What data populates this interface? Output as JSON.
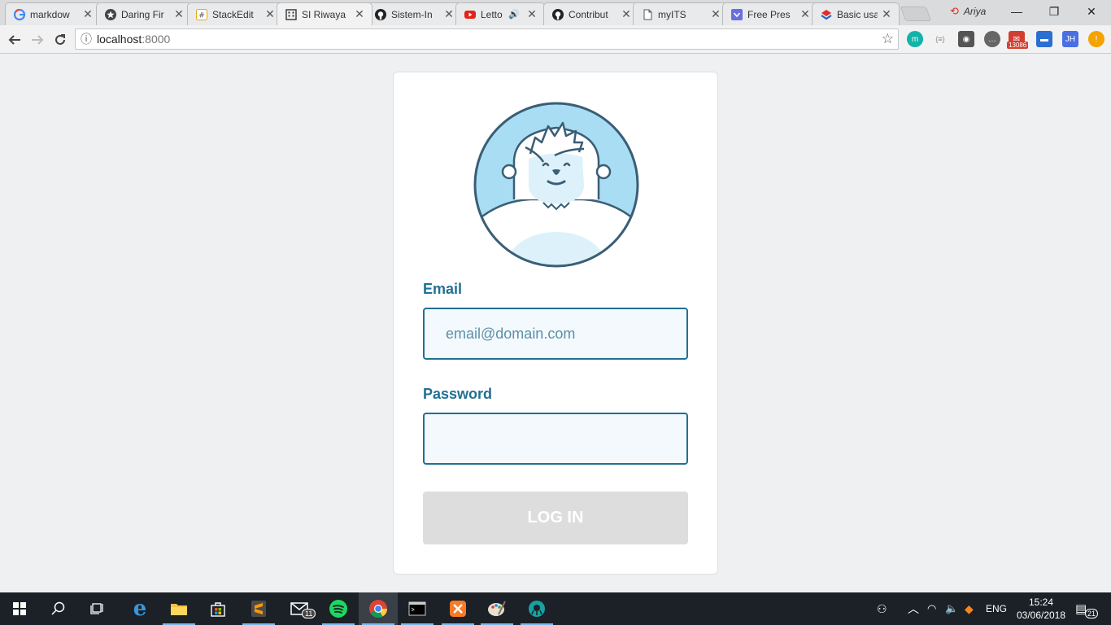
{
  "browser": {
    "tabs": [
      {
        "title": "markdow",
        "icon": "google-icon"
      },
      {
        "title": "Daring Fir",
        "icon": "star-icon"
      },
      {
        "title": "StackEdit",
        "icon": "stackedit-icon"
      },
      {
        "title": "SI Riwaya",
        "icon": "building-icon"
      },
      {
        "title": "Sistem-In",
        "icon": "github-icon"
      },
      {
        "title": "Letto",
        "icon": "youtube-icon"
      },
      {
        "title": "Contribut",
        "icon": "github-icon"
      },
      {
        "title": "myITS",
        "icon": "page-icon"
      },
      {
        "title": "Free Pres",
        "icon": "slides-icon"
      },
      {
        "title": "Basic usa",
        "icon": "layers-icon"
      }
    ],
    "profile_name": "Ariya",
    "url_host": "localhost",
    "url_port": ":8000",
    "extension_badge": "13086"
  },
  "login": {
    "email_label": "Email",
    "email_placeholder": "email@domain.com",
    "password_label": "Password",
    "button_label": "LOG IN"
  },
  "taskbar": {
    "mail_badge": "11",
    "language": "ENG",
    "time": "15:24",
    "date": "03/06/2018",
    "notification_count": "21"
  },
  "colors": {
    "accent": "#217093",
    "field_bg": "#f3f9fc",
    "button_disabled": "#dddddd",
    "avatar_fill": "#a9ddf3"
  }
}
